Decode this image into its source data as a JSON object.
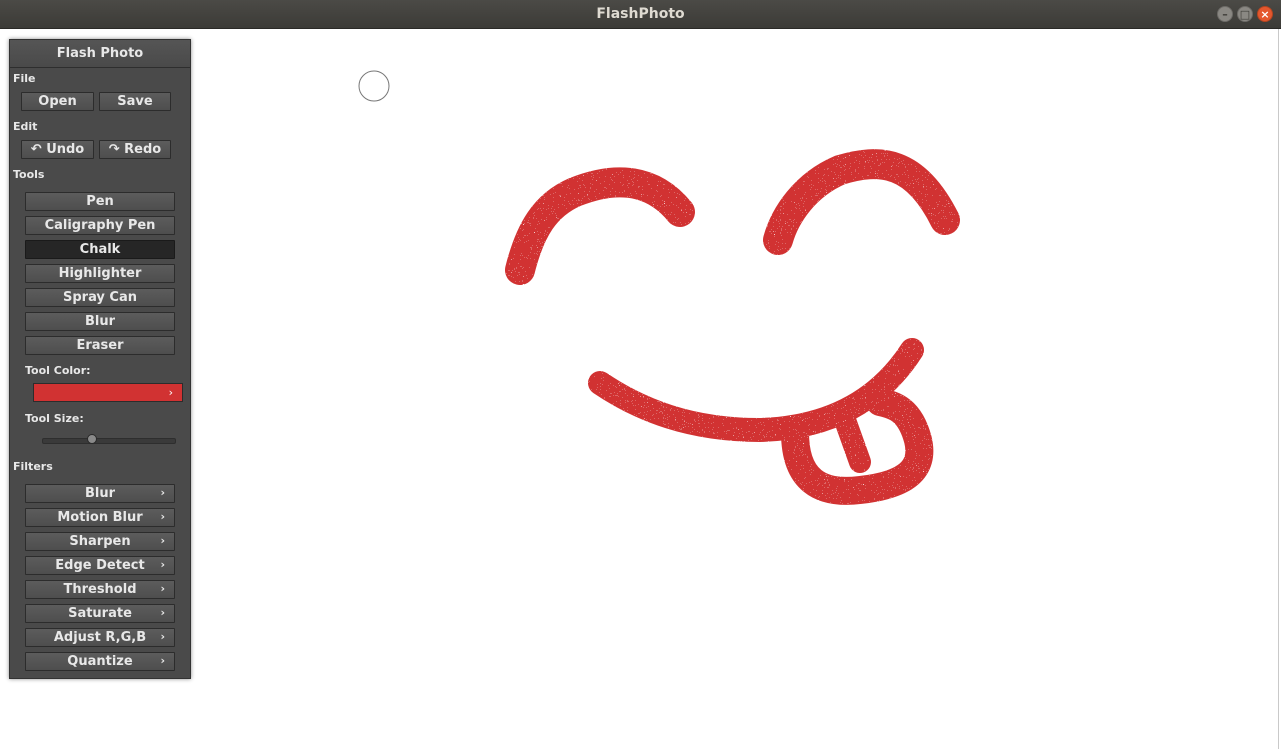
{
  "window": {
    "title": "FlashPhoto",
    "controls": [
      "minimize-icon",
      "maximize-icon",
      "close-icon"
    ]
  },
  "panel": {
    "title": "Flash Photo",
    "file": {
      "label": "File",
      "open": "Open",
      "save": "Save"
    },
    "edit": {
      "label": "Edit",
      "undo": "Undo",
      "redo": "Redo",
      "undo_icon": "undo-arrow-icon",
      "redo_icon": "redo-arrow-icon"
    },
    "tools": {
      "label": "Tools",
      "items": [
        "Pen",
        "Caligraphy Pen",
        "Chalk",
        "Highlighter",
        "Spray Can",
        "Blur",
        "Eraser"
      ],
      "selected": "Chalk"
    },
    "tool_color": {
      "label": "Tool Color:",
      "value": "#d13232"
    },
    "tool_size": {
      "label": "Tool Size:",
      "level": 0.38
    },
    "filters": {
      "label": "Filters",
      "items": [
        "Blur",
        "Motion Blur",
        "Sharpen",
        "Edge Detect",
        "Threshold",
        "Saturate",
        "Adjust R,G,B",
        "Quantize"
      ]
    }
  },
  "colors": {
    "panel_bg": "#4a4a4a",
    "titlebar_bg": "#3c3b37",
    "selected_tool_bg": "#262626",
    "stroke_color": "#d13232",
    "close_button": "#e4572e"
  }
}
